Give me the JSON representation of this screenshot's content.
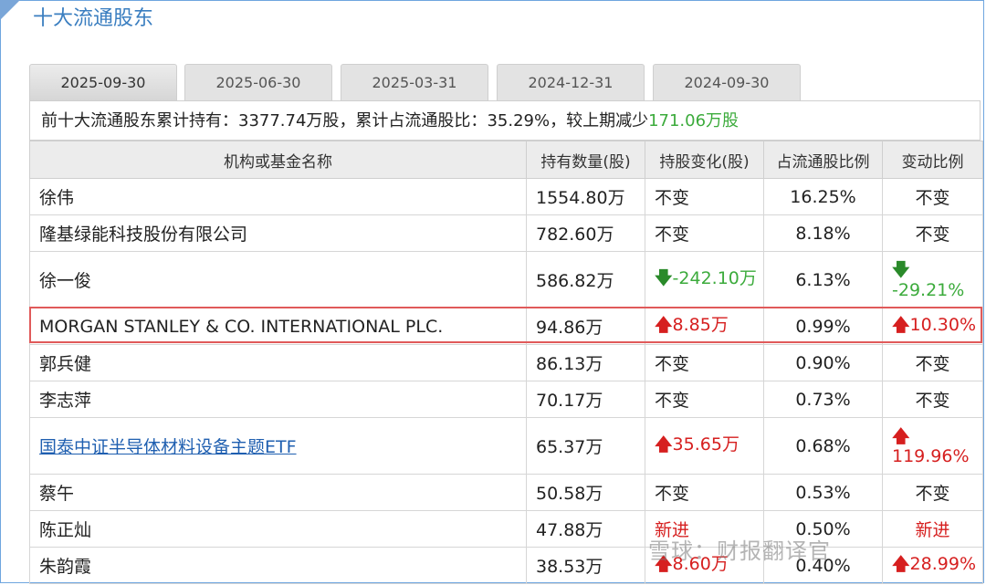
{
  "section_title": "十大流通股东",
  "tabs": [
    "2025-09-30",
    "2025-06-30",
    "2025-03-31",
    "2024-12-31",
    "2024-09-30"
  ],
  "summary": {
    "prefix": "前十大流通股东累计持有：",
    "holding": "3377.74万股",
    "mid": "，累计占流通股比：",
    "ratio": "35.29%",
    "sep": "，较上期减少",
    "change": "171.06万股"
  },
  "columns": [
    "机构或基金名称",
    "持有数量(股)",
    "持股变化(股)",
    "占流通股比例",
    "变动比例"
  ],
  "rows": [
    {
      "name": "徐伟",
      "qty": "1554.80万",
      "change": "不变",
      "ratio": "16.25%",
      "pct": "不变"
    },
    {
      "name": "隆基绿能科技股份有限公司",
      "qty": "782.60万",
      "change": "不变",
      "ratio": "8.18%",
      "pct": "不变"
    },
    {
      "name": "徐一俊",
      "qty": "586.82万",
      "change": "-242.10万",
      "ratio": "6.13%",
      "pct": "-29.21%"
    },
    {
      "name": "MORGAN STANLEY & CO. INTERNATIONAL PLC.",
      "qty": "94.86万",
      "change": "8.85万",
      "ratio": "0.99%",
      "pct": "10.30%"
    },
    {
      "name": "郭兵健",
      "qty": "86.13万",
      "change": "不变",
      "ratio": "0.90%",
      "pct": "不变"
    },
    {
      "name": "李志萍",
      "qty": "70.17万",
      "change": "不变",
      "ratio": "0.73%",
      "pct": "不变"
    },
    {
      "name": "国泰中证半导体材料设备主题ETF",
      "qty": "65.37万",
      "change": "35.65万",
      "ratio": "0.68%",
      "pct": "119.96%"
    },
    {
      "name": "蔡午",
      "qty": "50.58万",
      "change": "不变",
      "ratio": "0.53%",
      "pct": "不变"
    },
    {
      "name": "陈正灿",
      "qty": "47.88万",
      "change": "新进",
      "ratio": "0.50%",
      "pct": "新进"
    },
    {
      "name": "朱韵霞",
      "qty": "38.53万",
      "change": "8.60万",
      "ratio": "0.40%",
      "pct": "28.99%"
    }
  ],
  "watermark": "雪球：财报翻译官",
  "colors": {
    "accent": "#3a7ec0",
    "up": "#d61f1f",
    "down": "#3cab3c"
  }
}
